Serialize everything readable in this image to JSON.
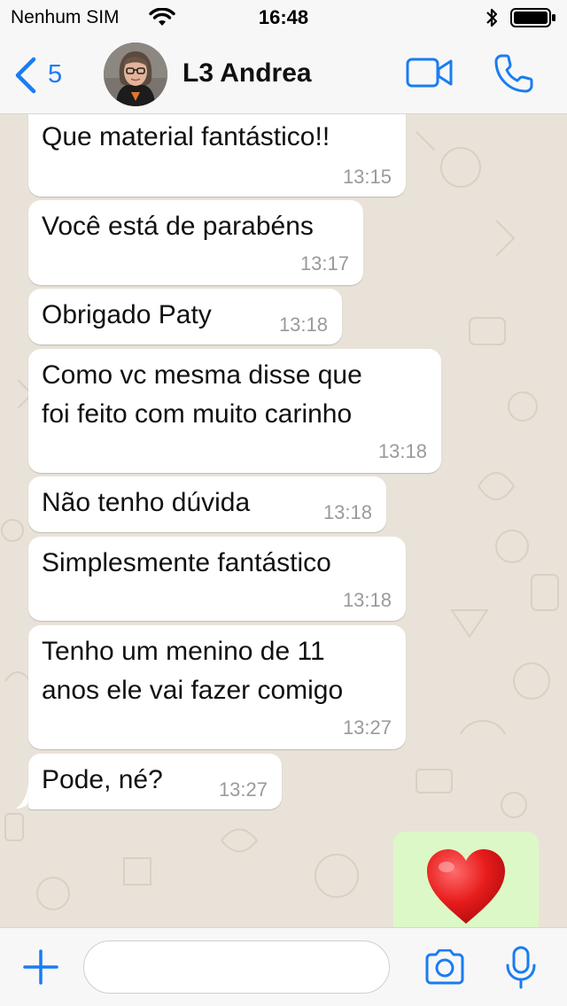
{
  "status_bar": {
    "carrier": "Nenhum SIM",
    "time": "16:48",
    "icons": [
      "wifi-icon",
      "bluetooth-icon",
      "battery-icon"
    ]
  },
  "header": {
    "back_count": "5",
    "contact_name": "L3 Andrea",
    "icons": [
      "chevron-left-icon",
      "video-camera-icon",
      "phone-icon"
    ]
  },
  "messages": [
    {
      "text": "Que material fantástico!!",
      "time": "13:15"
    },
    {
      "text": "Você está de parabéns",
      "time": "13:17"
    },
    {
      "text": "Obrigado Paty",
      "time": "13:18"
    },
    {
      "text": "Como vc mesma disse que",
      "text2": "foi feito com muito carinho",
      "time": "13:18"
    },
    {
      "text": "Não tenho dúvida",
      "time": "13:18"
    },
    {
      "text": "Simplesmente fantástico",
      "time": "13:18"
    },
    {
      "text": "Tenho um menino de 11",
      "text2": "anos ele vai fazer comigo",
      "time": "13:27"
    },
    {
      "text": "Pode, né?",
      "time": "13:27"
    }
  ],
  "sent_message": {
    "emoji": "heart-icon"
  },
  "input_bar": {
    "placeholder": "",
    "icons": [
      "plus-icon",
      "camera-icon",
      "microphone-icon"
    ]
  },
  "colors": {
    "accent": "#1a7cf2",
    "chat_background": "#e9e2d8",
    "incoming_bubble": "#ffffff",
    "outgoing_bubble": "#dcf8c6",
    "timestamp": "#9a9a9a"
  }
}
